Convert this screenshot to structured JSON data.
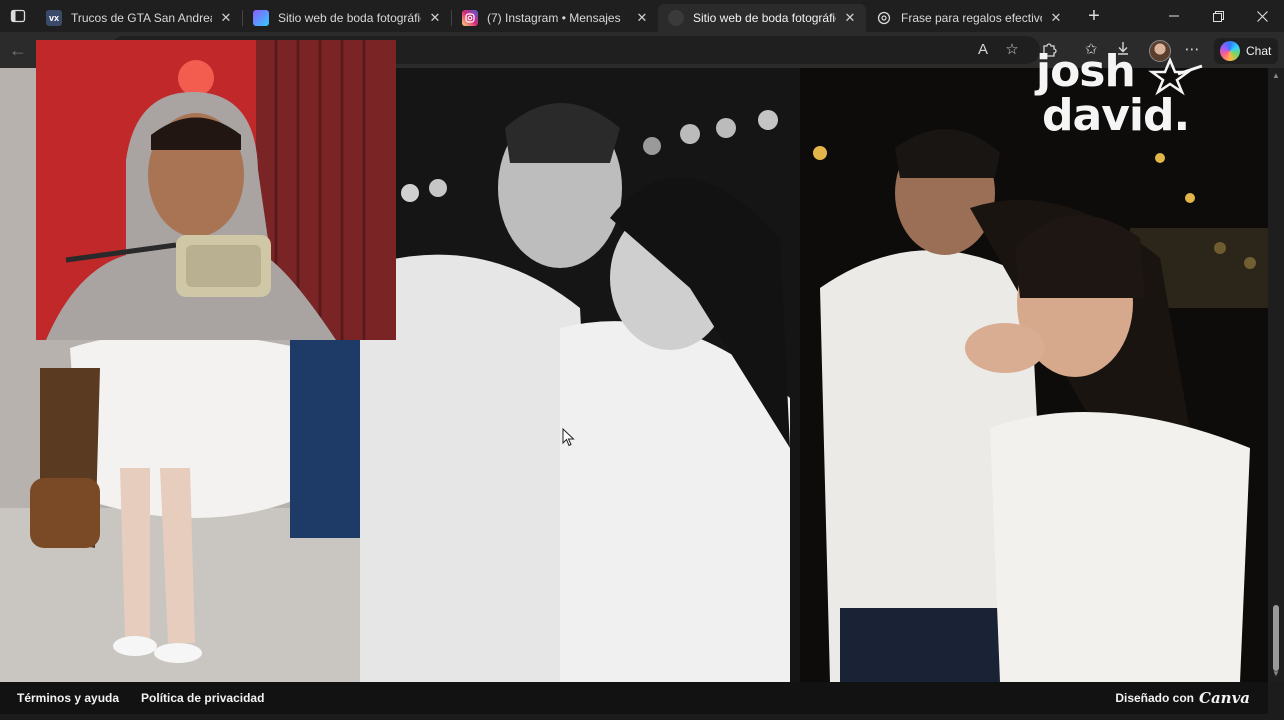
{
  "tabs": [
    {
      "title": "Trucos de GTA San Andreas pa",
      "favicon": "vx",
      "favicon_color": "#3a4a6b",
      "active": false
    },
    {
      "title": "Sitio web de boda fotográfico",
      "favicon": "",
      "favicon_color": "#7b5cff",
      "active": false
    },
    {
      "title": "(7) Instagram • Mensajes",
      "favicon": "",
      "favicon_color": "#d6249f",
      "active": false
    },
    {
      "title": "Sitio web de boda fotográfico",
      "favicon": "",
      "favicon_color": "#333333",
      "active": true
    },
    {
      "title": "Frase para regalos efectivos",
      "favicon": "",
      "favicon_color": "#555555",
      "active": false
    }
  ],
  "toolbar": {
    "chat_label": "Chat"
  },
  "page": {
    "brand_line1": "josh",
    "brand_line2": "david."
  },
  "footer": {
    "terms": "Términos y ayuda",
    "privacy": "Política de privacidad",
    "made_with": "Diseñado con",
    "made_with_brand": "Canva"
  },
  "colors": {
    "tab_strip": "#1f1f1f",
    "active_tab": "#2b2b2b",
    "footer": "#121212",
    "webcam_red": "#c0282a"
  }
}
